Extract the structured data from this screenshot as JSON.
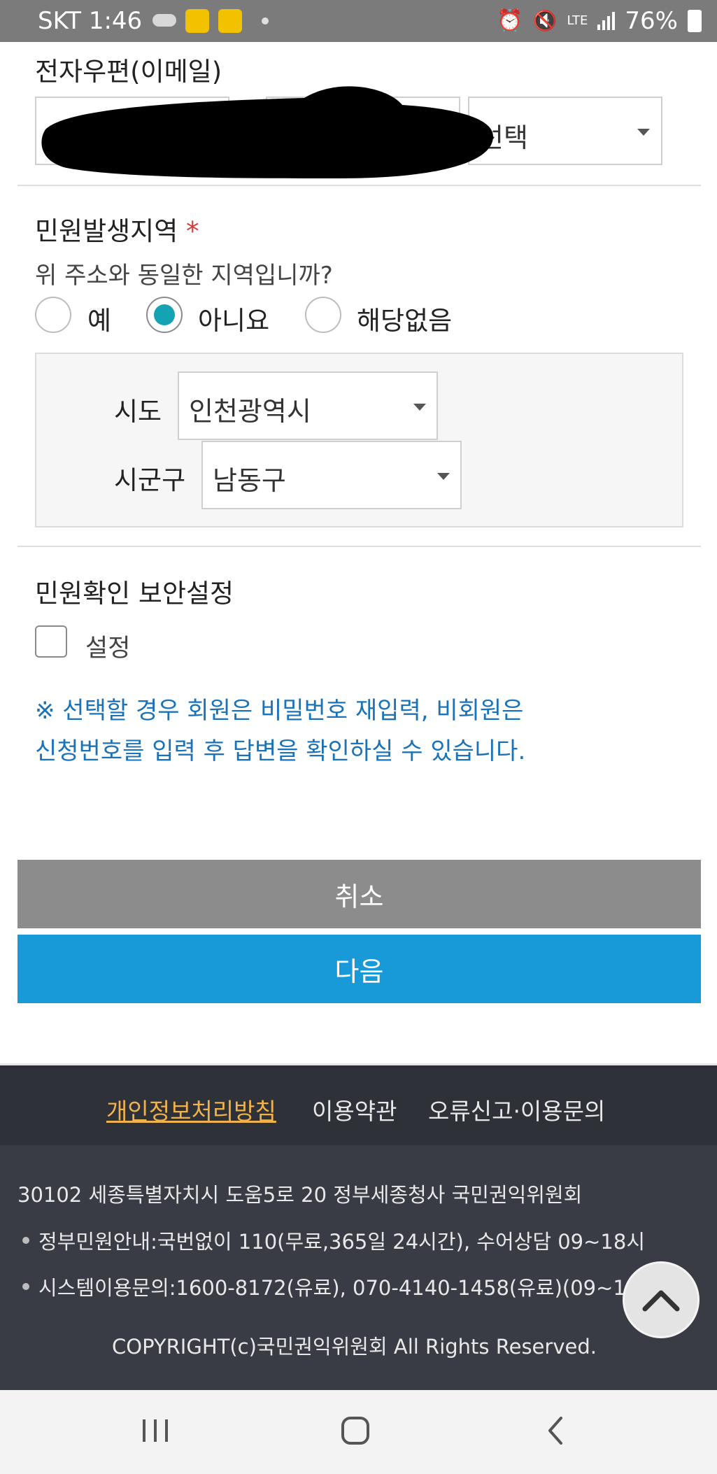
{
  "status_bar": {
    "carrier_time": "SKT 1:46",
    "network": "LTE",
    "battery": "76%"
  },
  "email": {
    "label": "전자우편(이메일)",
    "domain_select": "선택"
  },
  "region": {
    "label": "민원발생지역",
    "required_mark": "*",
    "question": "위 주소와 동일한 지역입니까?",
    "options": [
      "예",
      "아니요",
      "해당없음"
    ],
    "selected": "아니요",
    "sido_label": "시도",
    "sido_value": "인천광역시",
    "sigungu_label": "시군구",
    "sigungu_value": "남동구"
  },
  "security": {
    "label": "민원확인 보안설정",
    "checkbox_label": "설정",
    "note_line1": "※ 선택할 경우 회원은 비밀번호 재입력, 비회원은",
    "note_line2": "신청번호를 입력 후 답변을 확인하실 수 있습니다."
  },
  "buttons": {
    "cancel": "취소",
    "next": "다음"
  },
  "footer": {
    "links": [
      "개인정보처리방침",
      "이용약관",
      "오류신고·이용문의"
    ],
    "address": "30102 세종특별자치시 도움5로 20 정부세종청사 국민권익위원회",
    "info1": "정부민원안내:국번없이 110(무료,365일 24시간), 수어상담 09~18시",
    "info2": "시스템이용문의:1600-8172(유료), 070-4140-1458(유료)(09~18시)",
    "copyright": "COPYRIGHT(c)국민권익위원회 All Rights Reserved."
  },
  "colors": {
    "accent_blue": "#189ad9",
    "cancel_gray": "#8c8c8c",
    "radio_teal": "#13a3b3",
    "link_highlight": "#f0b24a",
    "note_blue": "#1a73b8"
  }
}
